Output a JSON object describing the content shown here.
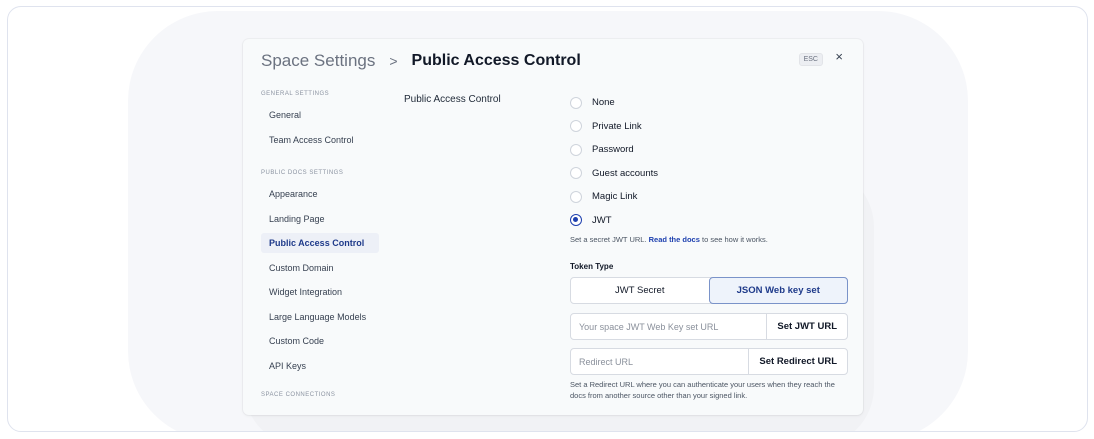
{
  "header": {
    "root": "Space Settings",
    "separator": ">",
    "current": "Public Access Control",
    "esc": "ESC",
    "close": "×"
  },
  "sidebar": {
    "general_title": "GENERAL SETTINGS",
    "general_items": [
      "General",
      "Team Access Control"
    ],
    "public_title": "PUBLIC DOCS SETTINGS",
    "public_items": [
      "Appearance",
      "Landing Page",
      "Public Access Control",
      "Custom Domain",
      "Widget Integration",
      "Large Language Models",
      "Custom Code",
      "API Keys"
    ],
    "active": "Public Access Control",
    "connections_title": "SPACE CONNECTIONS"
  },
  "content": {
    "field_label": "Public Access Control",
    "options": [
      "None",
      "Private Link",
      "Password",
      "Guest accounts",
      "Magic Link",
      "JWT"
    ],
    "selected": "JWT",
    "helper_prefix": "Set a secret JWT URL. ",
    "helper_link": "Read the docs",
    "helper_suffix": " to see how it works.",
    "token_type_label": "Token Type",
    "token_tabs": [
      "JWT Secret",
      "JSON Web key set"
    ],
    "token_active": "JSON Web key set",
    "jwt_url_placeholder": "Your space JWT Web Key set URL",
    "jwt_url_button": "Set JWT URL",
    "redirect_placeholder": "Redirect URL",
    "redirect_button": "Set Redirect URL",
    "footer_note": "Set a Redirect URL where you can authenticate your users when they reach the docs from another source other than your signed link."
  },
  "colors": {
    "accent": "#1e40af",
    "active_nav_bg": "#edf0f7"
  }
}
